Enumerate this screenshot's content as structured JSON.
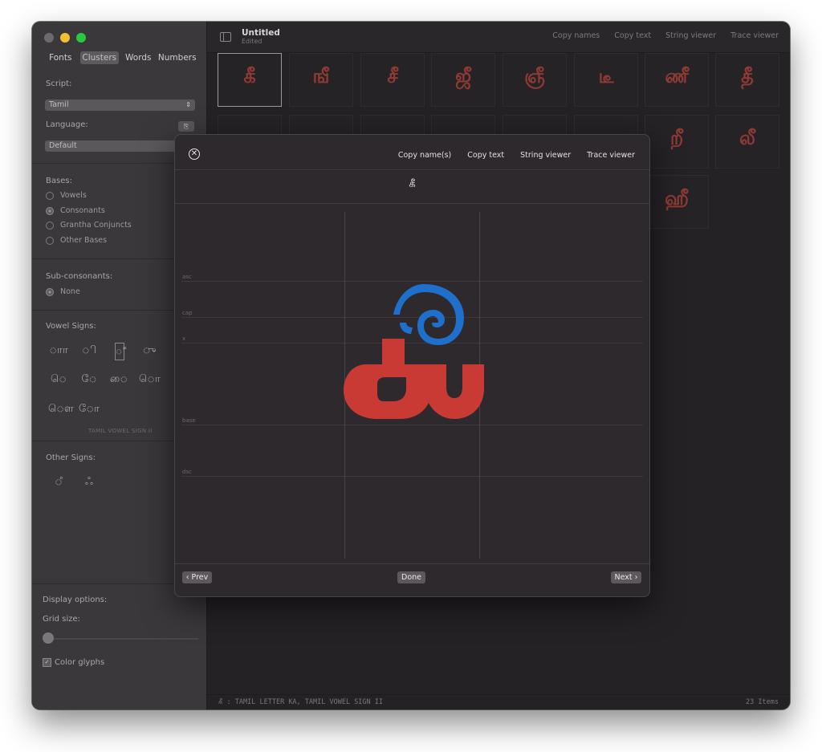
{
  "window": {
    "title": "Untitled",
    "subtitle": "Edited"
  },
  "sidebar": {
    "tabs": [
      "Fonts",
      "Clusters",
      "Words",
      "Numbers"
    ],
    "active_tab": "Clusters",
    "script_label": "Script:",
    "script_value": "Tamil",
    "language_label": "Language:",
    "language_value": "Default",
    "bases_label": "Bases:",
    "bases": [
      {
        "label": "Vowels",
        "selected": false
      },
      {
        "label": "Consonants",
        "selected": true
      },
      {
        "label": "Grantha Conjuncts",
        "selected": false
      },
      {
        "label": "Other Bases",
        "selected": false
      }
    ],
    "subcons_label": "Sub-consonants:",
    "subcons": [
      {
        "label": "None",
        "selected": true
      }
    ],
    "vowel_signs_label": "Vowel Signs:",
    "vowel_signs_row1": [
      "ாா",
      "ி",
      "ீ",
      "ு"
    ],
    "vowel_signs_row2": [
      "ெ",
      "ே",
      "ை",
      "ொ"
    ],
    "vowel_signs_row3": [
      "ௌ",
      "ோ"
    ],
    "vowel_sign_caption": "TAMIL VOWEL SIGN II",
    "other_signs_label": "Other Signs:",
    "other_signs": [
      "ஂ",
      "ஃ"
    ],
    "display_options_label": "Display options:",
    "grid_size_label": "Grid size:",
    "grid_size_value": 0,
    "color_glyphs_label": "Color glyphs",
    "color_glyphs_checked": true
  },
  "toolbar": {
    "actions": [
      "Copy names",
      "Copy text",
      "String viewer",
      "Trace viewer"
    ]
  },
  "grid": {
    "row1": [
      "கீ",
      "ஙீ",
      "சீ",
      "ஜீ",
      "ஞீ",
      "டீ",
      "ணீ",
      "தீ"
    ],
    "row2_visible": [
      "றீ",
      "லீ"
    ],
    "row3_visible": [
      "ஹீ"
    ]
  },
  "sheet": {
    "actions": [
      "Copy name(s)",
      "Copy text",
      "String viewer",
      "Trace viewer"
    ],
    "cluster": "கீ",
    "metric_labels": [
      "asc",
      "cap",
      "x",
      "base",
      "dsc"
    ],
    "prev_label": "‹ Prev",
    "done_label": "Done",
    "next_label": "Next ›",
    "glyph_colors": {
      "base": "#c93a35",
      "mark": "#1f6fcc"
    }
  },
  "status": {
    "left": "கீ : TAMIL LETTER KA, TAMIL VOWEL SIGN II",
    "right": "23 Items"
  }
}
